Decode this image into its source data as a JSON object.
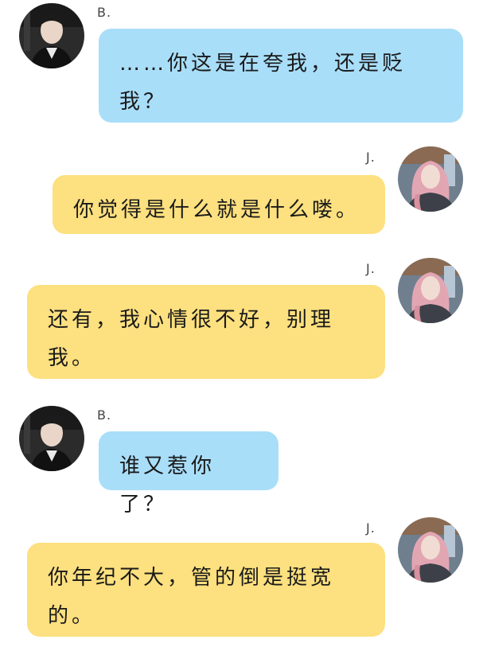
{
  "participants": {
    "b": {
      "name": "B.",
      "avatar_icon": "male-avatar-icon",
      "bubble_color": "#a9def9"
    },
    "j": {
      "name": "J.",
      "avatar_icon": "female-avatar-icon",
      "bubble_color": "#fde07f"
    }
  },
  "messages": [
    {
      "sender": "B.",
      "side": "left",
      "text": "……你这是在夸我，还是贬我？"
    },
    {
      "sender": "J.",
      "side": "right",
      "text": "你觉得是什么就是什么喽。"
    },
    {
      "sender": "J.",
      "side": "right",
      "text": "还有，我心情很不好，别理我。"
    },
    {
      "sender": "B.",
      "side": "left",
      "text": "谁又惹你了？"
    },
    {
      "sender": "J.",
      "side": "right",
      "text": "你年纪不大，管的倒是挺宽的。"
    }
  ]
}
